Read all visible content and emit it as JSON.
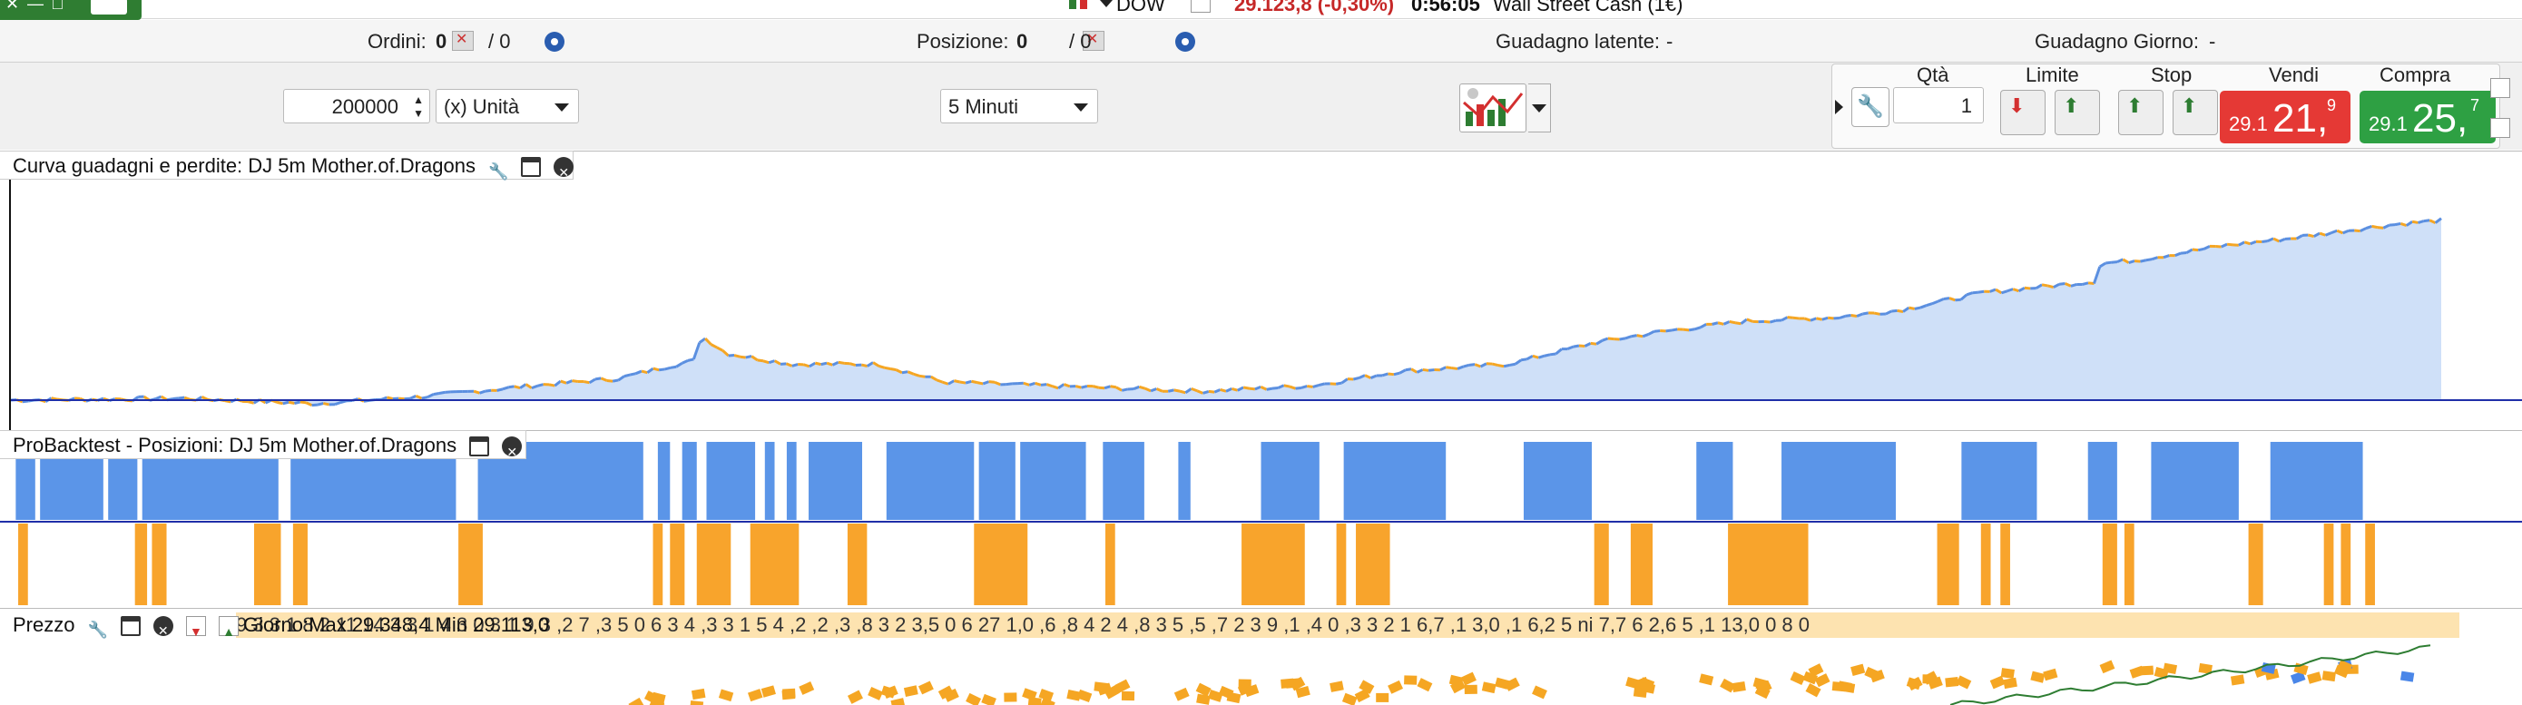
{
  "topbar": {
    "instrument": "DOW",
    "price_change": "29.123,8 (-0,30%)",
    "time": "0:56:05",
    "market_name": "Wall Street Cash (1€)"
  },
  "inforow": {
    "orders_label": "Ordini:",
    "orders_count": "0",
    "orders_auto_count": "/ 0",
    "position_label": "Posizione:",
    "position_count": "0",
    "position_auto_count": "/ 0",
    "latent_gain_label": "Guadagno latente:",
    "latent_gain_value": "-",
    "day_gain_label": "Guadagno Giorno:",
    "day_gain_value": "-"
  },
  "controls": {
    "quantity_value": "200000",
    "unit_select": "(x) Unità",
    "timeframe_select": "5 Minuti"
  },
  "trade": {
    "qty_label": "Qtà",
    "qty_value": "1",
    "limit_label": "Limite",
    "stop_label": "Stop",
    "sell_label": "Vendi",
    "buy_label": "Compra",
    "sell_price_small": "29.1",
    "sell_price_big": "21,",
    "sell_price_sup": "9",
    "buy_price_small": "29.1",
    "buy_price_big": "25,",
    "buy_price_sup": "7"
  },
  "equity_panel": {
    "title": "Curva guadagni e perdite: DJ 5m Mother.of.Dragons",
    "fill_color": "#cfe0f8",
    "line_color_up": "#5b8fe0",
    "line_color_down": "#f5a623",
    "baseline_color": "#1f2fa8"
  },
  "positions_panel": {
    "title": "ProBacktest - Posizioni: DJ 5m Mother.of.Dragons",
    "long_color": "#5b95e8",
    "short_color": "#f8a42c",
    "long_blocks": [
      [
        0.002,
        0.01
      ],
      [
        0.012,
        0.038
      ],
      [
        0.04,
        0.052
      ],
      [
        0.054,
        0.11
      ],
      [
        0.115,
        0.183
      ],
      [
        0.192,
        0.26
      ],
      [
        0.266,
        0.271
      ],
      [
        0.276,
        0.282
      ],
      [
        0.286,
        0.306
      ],
      [
        0.31,
        0.314
      ],
      [
        0.319,
        0.323
      ],
      [
        0.328,
        0.35
      ],
      [
        0.36,
        0.396
      ],
      [
        0.398,
        0.413
      ],
      [
        0.415,
        0.442
      ],
      [
        0.449,
        0.466
      ],
      [
        0.48,
        0.485
      ],
      [
        0.514,
        0.538
      ],
      [
        0.548,
        0.59
      ],
      [
        0.622,
        0.65
      ],
      [
        0.693,
        0.708
      ],
      [
        0.728,
        0.775
      ],
      [
        0.802,
        0.833
      ],
      [
        0.854,
        0.866
      ],
      [
        0.88,
        0.916
      ],
      [
        0.929,
        0.967
      ]
    ],
    "short_blocks": [
      [
        0.003,
        0.007
      ],
      [
        0.051,
        0.056
      ],
      [
        0.058,
        0.064
      ],
      [
        0.1,
        0.111
      ],
      [
        0.116,
        0.122
      ],
      [
        0.184,
        0.194
      ],
      [
        0.264,
        0.268
      ],
      [
        0.271,
        0.277
      ],
      [
        0.282,
        0.296
      ],
      [
        0.304,
        0.324
      ],
      [
        0.344,
        0.35
      ],
      [
        0.35,
        0.352
      ],
      [
        0.396,
        0.418
      ],
      [
        0.45,
        0.454
      ],
      [
        0.506,
        0.532
      ],
      [
        0.545,
        0.549
      ],
      [
        0.553,
        0.567
      ],
      [
        0.651,
        0.657
      ],
      [
        0.666,
        0.675
      ],
      [
        0.706,
        0.739
      ],
      [
        0.792,
        0.801
      ],
      [
        0.81,
        0.814
      ],
      [
        0.818,
        0.822
      ],
      [
        0.86,
        0.866
      ],
      [
        0.869,
        0.873
      ],
      [
        0.92,
        0.926
      ],
      [
        0.951,
        0.955
      ],
      [
        0.958,
        0.962
      ],
      [
        0.968,
        0.972
      ]
    ]
  },
  "price_panel": {
    "title": "Prezzo",
    "day_range": "Giorno:Max 29.348,4 Min 29.113,0",
    "label_strip": "9 3 3 1 8 2 11 14 3 3 1 4 3 0 3 1 9 3 ,2 7 ,3 5 0 6 3 4 ,3 3 1 5 4 ,2 ,2 ,3 ,8 3 2 3,5 0 6 27 1,0 ,6 ,8 4 2 4 ,8 3 5 ,5 ,7 2 3 9 ,1 ,4 0 ,3 3 2 1 6,7 ,1 3,0 ,1 6,2 5 ni 7,7 6 2,6 5 ,1 13,0 0 8 0"
  }
}
